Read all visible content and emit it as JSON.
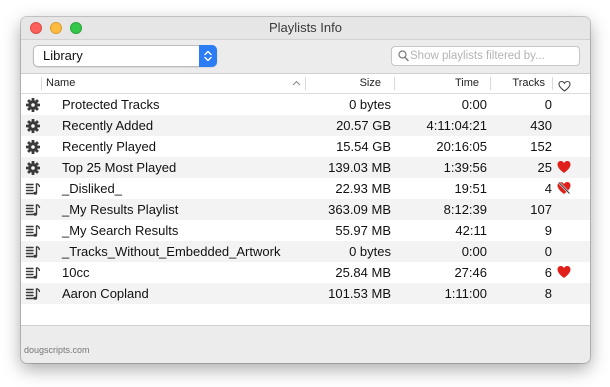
{
  "window": {
    "title": "Playlists Info"
  },
  "toolbar": {
    "source_popup": {
      "value": "Library"
    },
    "search": {
      "placeholder": "Show playlists filtered by...",
      "value": ""
    }
  },
  "table": {
    "columns": {
      "name": "Name",
      "size": "Size",
      "time": "Time",
      "tracks": "Tracks",
      "loved_icon": "heart-outline-icon"
    },
    "sort": {
      "column": "name",
      "direction": "ascending"
    },
    "rows": [
      {
        "icon": "gear-icon",
        "name": "Protected Tracks",
        "size": "0 bytes",
        "time": "0:00",
        "tracks": "0",
        "loved": "none"
      },
      {
        "icon": "gear-icon",
        "name": "Recently Added",
        "size": "20.57 GB",
        "time": "4:11:04:21",
        "tracks": "430",
        "loved": "none"
      },
      {
        "icon": "gear-icon",
        "name": "Recently Played",
        "size": "15.54 GB",
        "time": "20:16:05",
        "tracks": "152",
        "loved": "none"
      },
      {
        "icon": "gear-icon",
        "name": "Top 25 Most Played",
        "size": "139.03 MB",
        "time": "1:39:56",
        "tracks": "25",
        "loved": "loved"
      },
      {
        "icon": "playlist-icon",
        "name": "_Disliked_",
        "size": "22.93 MB",
        "time": "19:51",
        "tracks": "4",
        "loved": "disliked"
      },
      {
        "icon": "playlist-icon",
        "name": "_My Results Playlist",
        "size": "363.09 MB",
        "time": "8:12:39",
        "tracks": "107",
        "loved": "none"
      },
      {
        "icon": "playlist-icon",
        "name": "_My Search Results",
        "size": "55.97 MB",
        "time": "42:11",
        "tracks": "9",
        "loved": "none"
      },
      {
        "icon": "playlist-icon",
        "name": "_Tracks_Without_Embedded_Artwork",
        "size": "0 bytes",
        "time": "0:00",
        "tracks": "0",
        "loved": "none"
      },
      {
        "icon": "playlist-icon",
        "name": "10cc",
        "size": "25.84 MB",
        "time": "27:46",
        "tracks": "6",
        "loved": "loved"
      },
      {
        "icon": "playlist-icon",
        "name": "Aaron Copland",
        "size": "101.53 MB",
        "time": "1:11:00",
        "tracks": "8",
        "loved": "none"
      }
    ]
  },
  "footer": {
    "credit": "dougscripts.com"
  },
  "colors": {
    "accent": "#2c7cf6",
    "heart": "#e0201b",
    "alt_row": "#f3f3f3"
  }
}
